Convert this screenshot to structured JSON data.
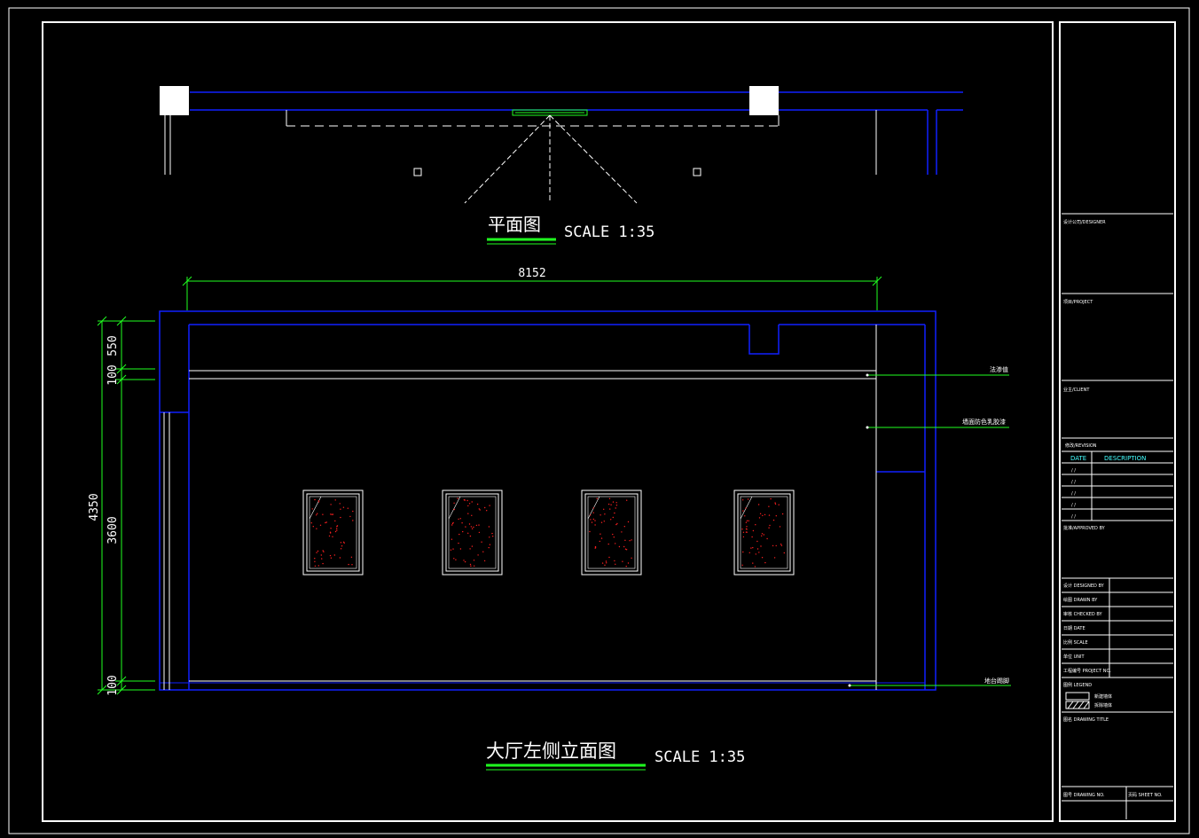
{
  "plan": {
    "title": "平面图",
    "scale": "SCALE 1:35"
  },
  "elevation": {
    "title": "大厅左侧立面图",
    "scale": "SCALE 1:35",
    "dimensions": {
      "width": "8152",
      "total_height": "4350",
      "height": "3600",
      "top": "550",
      "band": "100",
      "base": "100"
    },
    "callouts": [
      "法渗值",
      "墙面防色乳胶漆",
      "地台踢脚"
    ]
  },
  "title_block": {
    "top_label": "设计公司/DESIGNER",
    "project_label": "项目/PROJECT",
    "client_label": "业主/CLIENT",
    "revision_label": "修改/REVISION",
    "revision_header_date": "DATE",
    "revision_header_desc": "DESCRIPTION",
    "revision_rows": [
      "/ /",
      "/ /",
      "/ /",
      "/ /",
      "/ /"
    ],
    "approved_label": "批准/APPROVED BY",
    "designed_label": "设计 DESIGNED BY",
    "drawn_label": "绘图 DRAWN BY",
    "checked_label": "审核 CHECKED BY",
    "date_label": "日期 DATE",
    "scale_label": "比例 SCALE",
    "unit_label": "单位 UNIT",
    "project_no_label": "工程编号 PROJECT NO.",
    "legend_label": "图例 LEGEND",
    "legend_1": "新建墙体",
    "legend_2": "拆除墙体",
    "drawing_label": "图名 DRAWING TITLE",
    "drawing_no_label": "图号 DRAWING NO.",
    "sheet_label": "页码 SHEET NO."
  },
  "colors": {
    "line_white": "#ffffff",
    "line_blue": "#1020ff",
    "line_green": "#20ff20",
    "accent_cyan": "#40ffff",
    "painting_red": "#ff2020"
  }
}
